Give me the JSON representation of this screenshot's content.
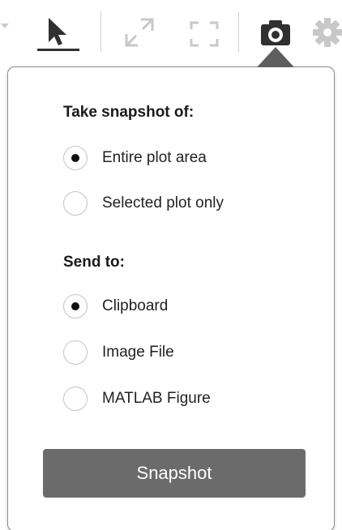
{
  "toolbar": {
    "tools": [
      {
        "name": "dropdown-arrow-icon"
      },
      {
        "name": "select-pointer-icon",
        "active": true
      },
      {
        "name": "expand-icon"
      },
      {
        "name": "fullscreen-icon"
      },
      {
        "name": "camera-icon",
        "active": true
      },
      {
        "name": "gear-icon"
      }
    ]
  },
  "snapshot_panel": {
    "take_heading": "Take snapshot of:",
    "take_options": [
      {
        "label": "Entire plot area",
        "checked": true
      },
      {
        "label": "Selected plot only",
        "checked": false
      }
    ],
    "send_heading": "Send to:",
    "send_options": [
      {
        "label": "Clipboard",
        "checked": true
      },
      {
        "label": "Image File",
        "checked": false
      },
      {
        "label": "MATLAB Figure",
        "checked": false
      }
    ],
    "button_label": "Snapshot"
  },
  "colors": {
    "active_icon": "#303030",
    "inactive_icon": "#c8c8c8",
    "button_bg": "#6b6b6b",
    "panel_border": "#8e8e8e"
  }
}
